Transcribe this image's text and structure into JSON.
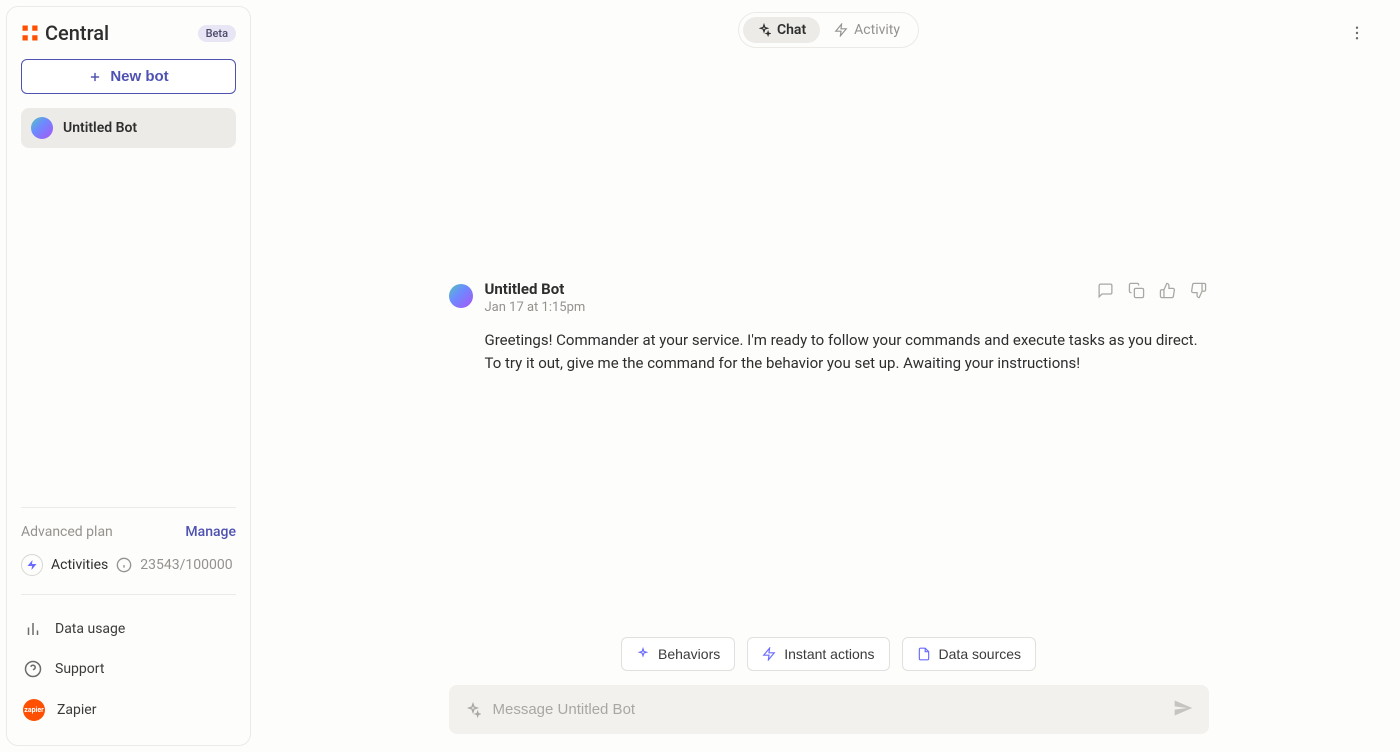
{
  "sidebar": {
    "logo_text": "Central",
    "beta_label": "Beta",
    "new_bot_label": "New bot",
    "bots": [
      {
        "name": "Untitled Bot",
        "active": true
      }
    ],
    "plan": {
      "label": "Advanced plan",
      "manage_label": "Manage",
      "activities_label": "Activities",
      "activities_count": "23543/100000"
    },
    "footer": {
      "data_usage": "Data usage",
      "support": "Support",
      "zapier": "Zapier",
      "zapier_icon_text": "zapier"
    }
  },
  "tabs": {
    "chat": "Chat",
    "activity": "Activity"
  },
  "message": {
    "author": "Untitled Bot",
    "timestamp": "Jan 17 at 1:15pm",
    "text": "Greetings! Commander at your service. I'm ready to follow your commands and execute tasks as you direct. To try it out, give me the command for the behavior you set up. Awaiting your instructions!"
  },
  "chips": {
    "behaviors": "Behaviors",
    "instant_actions": "Instant actions",
    "data_sources": "Data sources"
  },
  "composer": {
    "placeholder": "Message Untitled Bot"
  },
  "colors": {
    "accent": "#4f52b1",
    "zapier_orange": "#ff4f00"
  }
}
